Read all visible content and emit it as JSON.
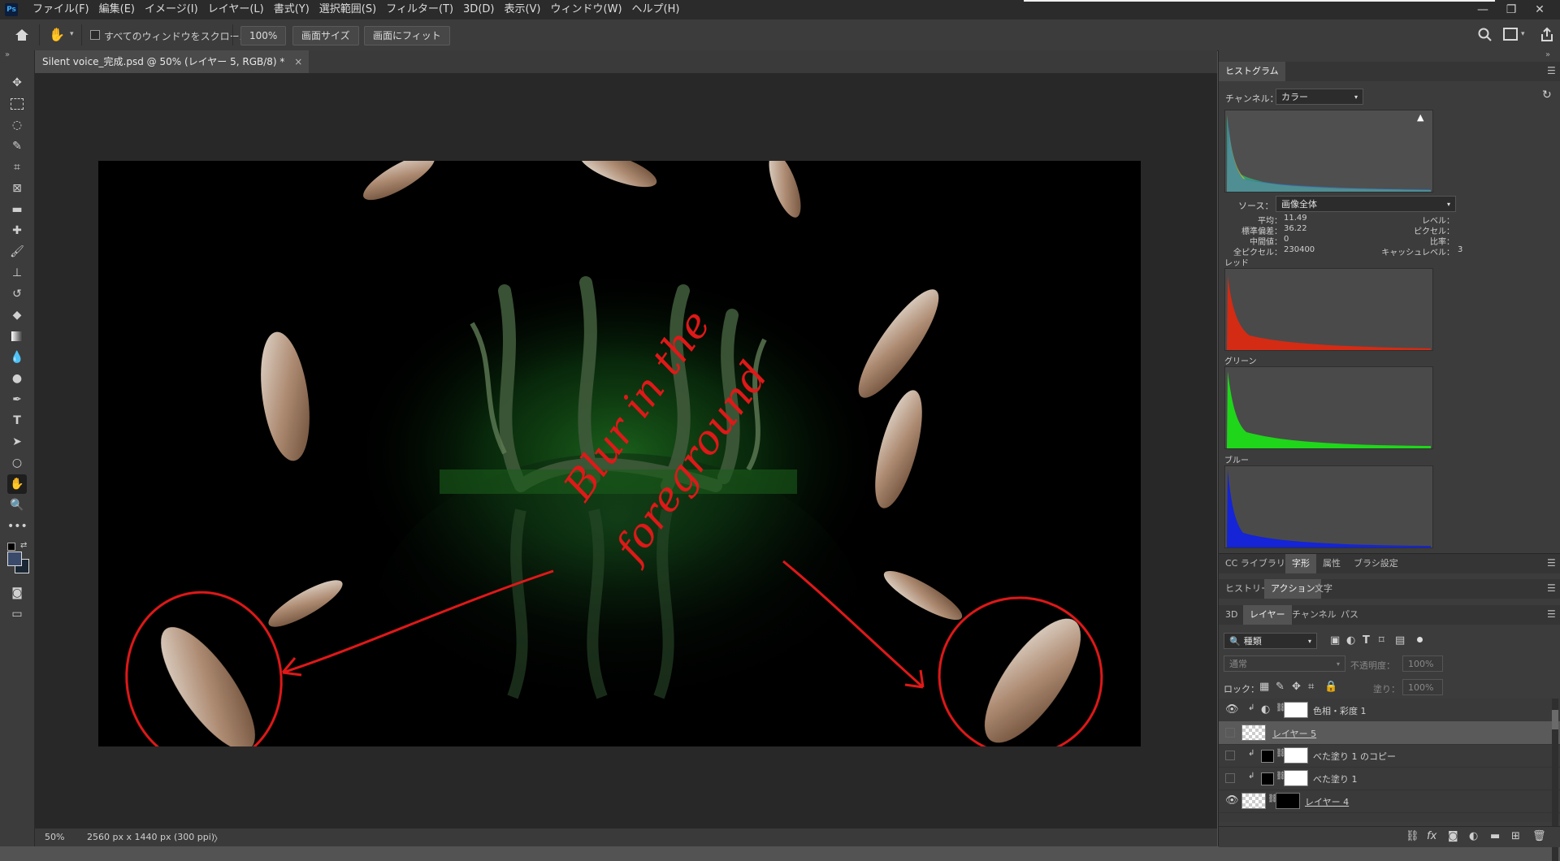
{
  "app": {
    "logo": "Ps"
  },
  "menu": [
    "ファイル(F)",
    "編集(E)",
    "イメージ(I)",
    "レイヤー(L)",
    "書式(Y)",
    "選択範囲(S)",
    "フィルター(T)",
    "3D(D)",
    "表示(V)",
    "ウィンドウ(W)",
    "ヘルプ(H)"
  ],
  "window_controls": {
    "minimize": "—",
    "restore": "❐",
    "close": "✕"
  },
  "options": {
    "scroll_all_label": "すべてのウィンドウをスクロール",
    "zoom_value": "100%",
    "screen_size_btn": "画面サイズ",
    "fit_screen_btn": "画面にフィット"
  },
  "document": {
    "tab_title": "Silent voice_完成.psd @ 50% (レイヤー 5, RGB/8) *",
    "close": "×",
    "annotation_text_line1": "Blur in the",
    "annotation_text_line2": "foreground"
  },
  "status": {
    "zoom": "50%",
    "info": "2560 px x 1440 px (300 ppi)",
    "arrow": "〉"
  },
  "histogram": {
    "tab": "ヒストグラム",
    "channel_label": "チャンネル：",
    "channel_value": "カラー",
    "source_label": "ソース：",
    "source_value": "画像全体",
    "stats_left": [
      {
        "label": "平均：",
        "value": "11.49"
      },
      {
        "label": "標準偏差：",
        "value": "36.22"
      },
      {
        "label": "中間値：",
        "value": "0"
      },
      {
        "label": "全ピクセル：",
        "value": "230400"
      }
    ],
    "stats_right": [
      {
        "label": "レベル：",
        "value": ""
      },
      {
        "label": "ピクセル：",
        "value": ""
      },
      {
        "label": "比率：",
        "value": ""
      },
      {
        "label": "キャッシュレベル：",
        "value": "3"
      }
    ],
    "red_label": "レッド",
    "green_label": "グリーン",
    "blue_label": "ブルー",
    "colors": {
      "red": "#d42b14",
      "green": "#1fd61a",
      "blue": "#1424d6"
    }
  },
  "panel_tabs_row1": [
    "CC ライブラリ",
    "字形",
    "属性",
    "ブラシ設定"
  ],
  "panel_tabs_row2": [
    "ヒストリー",
    "アクション",
    "文字"
  ],
  "panel_tabs_row3": [
    "3D",
    "レイヤー",
    "チャンネル",
    "パス"
  ],
  "layers_panel": {
    "filter_kind": "種類",
    "blend_mode": "通常",
    "opacity_label": "不透明度：",
    "opacity_value": "100%",
    "lock_label": "ロック：",
    "fill_label": "塗り：",
    "fill_value": "100%",
    "layers": [
      {
        "name": "色相・彩度 1"
      },
      {
        "name": "レイヤー 5"
      },
      {
        "name": "べた塗り 1 のコピー"
      },
      {
        "name": "べた塗り 1"
      },
      {
        "name": "レイヤー 4"
      }
    ],
    "bottom_icons": [
      "link-icon",
      "fx-icon",
      "mask-icon",
      "adjustment-icon",
      "folder-icon",
      "new-layer-icon",
      "trash-icon"
    ]
  }
}
